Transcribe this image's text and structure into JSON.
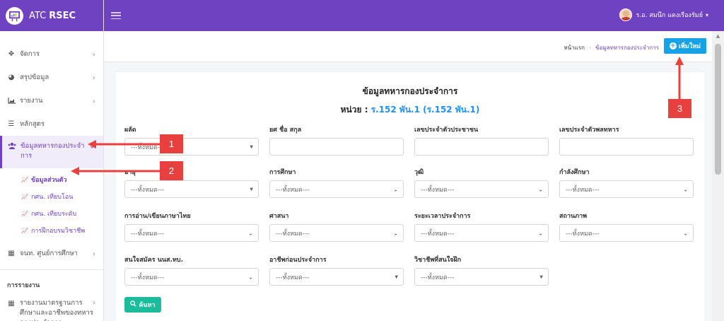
{
  "brand": {
    "prefix": "ATC ",
    "name": "RSEC",
    "icon": "school-board-icon"
  },
  "user": {
    "name": "ร.อ. สมนึก แดงเรืองรัมย์",
    "caret": "▾"
  },
  "sidebar": {
    "items": [
      {
        "label": "จัดการ",
        "icon": "move-icon",
        "chevron": "›"
      },
      {
        "label": "สรุปข้อมูล",
        "icon": "pie-chart-icon",
        "chevron": "›"
      },
      {
        "label": "รายงาน",
        "icon": "area-chart-icon",
        "chevron": "›"
      },
      {
        "label": "หลักสูตร",
        "icon": "list-icon"
      },
      {
        "label": "ข้อมูลทหารกองประจำการ",
        "icon": "users-icon",
        "chevron": "⌄"
      }
    ],
    "subitems": [
      {
        "label": "ข้อมูลส่วนตัว"
      },
      {
        "label": "กศน. เทียบโอน"
      },
      {
        "label": "กศน. เทียบระดับ"
      },
      {
        "label": "การฝึกอบรมวิชาชีพ"
      }
    ],
    "item_center": {
      "label": "จนท. ศูนย์การศึกษา",
      "chevron": "›"
    },
    "section_header": "การรายงาน",
    "report_item": {
      "label": "รายงานมาตรฐานการศึกษาและอาชีพของทหารกองประจำการ",
      "chevron": "›"
    }
  },
  "breadcrumb": {
    "home": "หน้าแรก",
    "current": "ข้อมูลทหารกองประจำการ",
    "sep": "›"
  },
  "new_button": {
    "label": "เพิ่มใหม่",
    "icon": "+"
  },
  "card": {
    "title": "ข้อมูลทหารกองประจำการ",
    "unit_label": "หน่วย : ",
    "unit_value": "ร.152 พัน.1 (ร.152 พัน.1)"
  },
  "filters": {
    "draft": {
      "label": "ผลัด",
      "value": "---ทั้งหมด---"
    },
    "rank_name": {
      "label": "ยศ ชื่อ สกุล",
      "value": ""
    },
    "citizen_id": {
      "label": "เลขประจำตัวประชาชน",
      "value": ""
    },
    "soldier_id": {
      "label": "เลขประจำตัวพลทหาร",
      "value": ""
    },
    "age": {
      "label": "อายุ",
      "value": "---ทั้งหมด---"
    },
    "education": {
      "label": "การศึกษา",
      "value": "---ทั้งหมด---"
    },
    "degree": {
      "label": "วุฒิ",
      "value": "---ทั้งหมด---"
    },
    "studying": {
      "label": "กำลังศึกษา",
      "value": "---ทั้งหมด---"
    },
    "thai_literacy": {
      "label": "การอ่าน/เขียนภาษาไทย",
      "value": "---ทั้งหมด---"
    },
    "religion": {
      "label": "ศาสนา",
      "value": "---ทั้งหมด---"
    },
    "service_period": {
      "label": "ระยะเวลาประจำการ",
      "value": "---ทั้งหมด---"
    },
    "status": {
      "label": "สถานภาพ",
      "value": "---ทั้งหมด---"
    },
    "nco_interest": {
      "label": "สนใจสมัคร นนส.ทบ.",
      "value": "---ทั้งหมด---"
    },
    "prev_occupation": {
      "label": "อาชีพก่อนประจำการ",
      "value": "---ทั้งหมด---"
    },
    "training_interest": {
      "label": "วิชาชีพที่สนใจฝึก",
      "value": "---ทั้งหมด---"
    }
  },
  "search_button": {
    "label": "ค้นหา",
    "icon": "search-icon"
  },
  "callouts": [
    "1",
    "2",
    "3"
  ],
  "colors": {
    "primary": "#6f42c1",
    "info": "#17a2e8",
    "success": "#1abc9c",
    "callout": "#e8403e"
  }
}
